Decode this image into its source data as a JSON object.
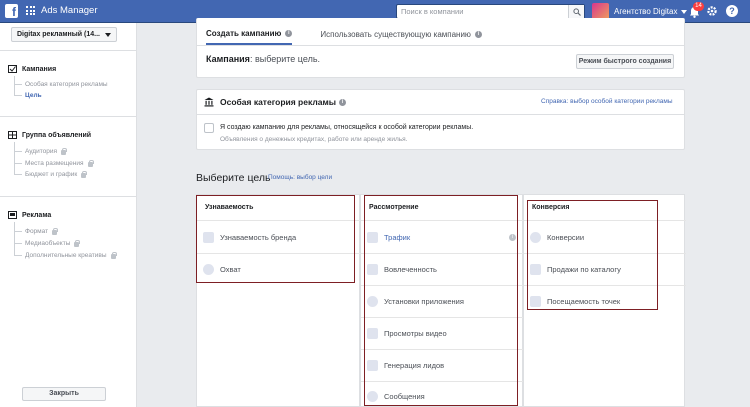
{
  "topbar": {
    "app_title": "Ads Manager",
    "search_placeholder": "Поиск в компании",
    "account_name": "Агентство Digitax",
    "notifications_count": "14",
    "help_label": "?"
  },
  "sidebar": {
    "account_select": "Digitax рекламный (14...",
    "sections": [
      {
        "title": "Кампания",
        "items": [
          {
            "label": "Особая категория рекламы",
            "locked": false,
            "active": false
          },
          {
            "label": "Цель",
            "locked": false,
            "active": true
          }
        ]
      },
      {
        "title": "Группа объявлений",
        "items": [
          {
            "label": "Аудитория",
            "locked": true
          },
          {
            "label": "Места размещения",
            "locked": true
          },
          {
            "label": "Бюджет и график",
            "locked": true
          }
        ]
      },
      {
        "title": "Реклама",
        "items": [
          {
            "label": "Формат",
            "locked": true
          },
          {
            "label": "Медиаобъекты",
            "locked": true
          },
          {
            "label": "Дополнительные креативы",
            "locked": true
          }
        ]
      }
    ],
    "close_label": "Закрыть"
  },
  "main": {
    "tabs": [
      {
        "label": "Создать кампанию",
        "active": true
      },
      {
        "label": "Использовать существующую кампанию",
        "active": false
      }
    ],
    "campaign_label": "Кампания",
    "campaign_prompt": ": выберите цель.",
    "quick_create_label": "Режим быстрого создания",
    "special_category": {
      "title": "Особая категория рекламы",
      "help_link": "Справка: выбор особой категории рекламы",
      "checkbox_label": "Я создаю кампанию для рекламы, относящейся к особой категории рекламы.",
      "checkbox_sub": "Объявления о денежных кредитах, работе или аренде жилья."
    },
    "goal_title": "Выберите цель",
    "goal_help": "Помощь: выбор цели",
    "objectives": [
      {
        "heading": "Узнаваемость",
        "items": [
          "Узнаваемость бренда",
          "Охват"
        ]
      },
      {
        "heading": "Рассмотрение",
        "items": [
          "Трафик",
          "Вовлеченность",
          "Установки приложения",
          "Просмотры видео",
          "Генерация лидов",
          "Сообщения"
        ]
      },
      {
        "heading": "Конверсия",
        "items": [
          "Конверсии",
          "Продажи по каталогу",
          "Посещаемость точек"
        ]
      }
    ]
  },
  "colors": {
    "brand": "#4267b2",
    "highlight_box": "#7d1f24"
  }
}
